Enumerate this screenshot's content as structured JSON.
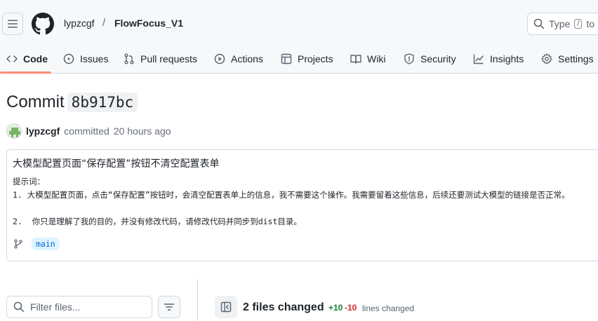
{
  "header": {
    "owner": "lypzcgf",
    "separator": "/",
    "repo": "FlowFocus_V1",
    "search_prefix": "Type",
    "search_key": "/",
    "search_suffix": "to"
  },
  "tabs": [
    {
      "label": "Code",
      "icon": "code-icon",
      "active": true
    },
    {
      "label": "Issues",
      "icon": "issue-icon"
    },
    {
      "label": "Pull requests",
      "icon": "pull-request-icon"
    },
    {
      "label": "Actions",
      "icon": "play-icon"
    },
    {
      "label": "Projects",
      "icon": "table-icon"
    },
    {
      "label": "Wiki",
      "icon": "book-icon"
    },
    {
      "label": "Security",
      "icon": "shield-icon"
    },
    {
      "label": "Insights",
      "icon": "graph-icon"
    },
    {
      "label": "Settings",
      "icon": "gear-icon"
    }
  ],
  "commit": {
    "title_word": "Commit",
    "sha": "8b917bc",
    "author": "lypzcgf",
    "action": "committed",
    "time": "20 hours ago",
    "message_title": "大模型配置页面“保存配置”按钮不清空配置表单",
    "message_body": [
      "提示词：",
      "1. 大模型配置页面，点击“保存配置”按钮时，会清空配置表单上的信息，我不需要这个操作。我需要留着这些信息，后续还要测试大模型的链接是否正常。",
      "",
      "2.  你只是理解了我的目的，并没有修改代码，请修改代码并同步到dist目录。"
    ],
    "branch": "main"
  },
  "files": {
    "filter_placeholder": "Filter files...",
    "changed_label": "2 files changed",
    "additions": "+10",
    "deletions": "-10",
    "lines_label": "lines changed"
  },
  "colors": {
    "accent_underline": "#fd8c73",
    "addition": "#1a7f37",
    "deletion": "#d1242f",
    "branch_bg": "#ddf4ff",
    "branch_fg": "#0969da"
  }
}
